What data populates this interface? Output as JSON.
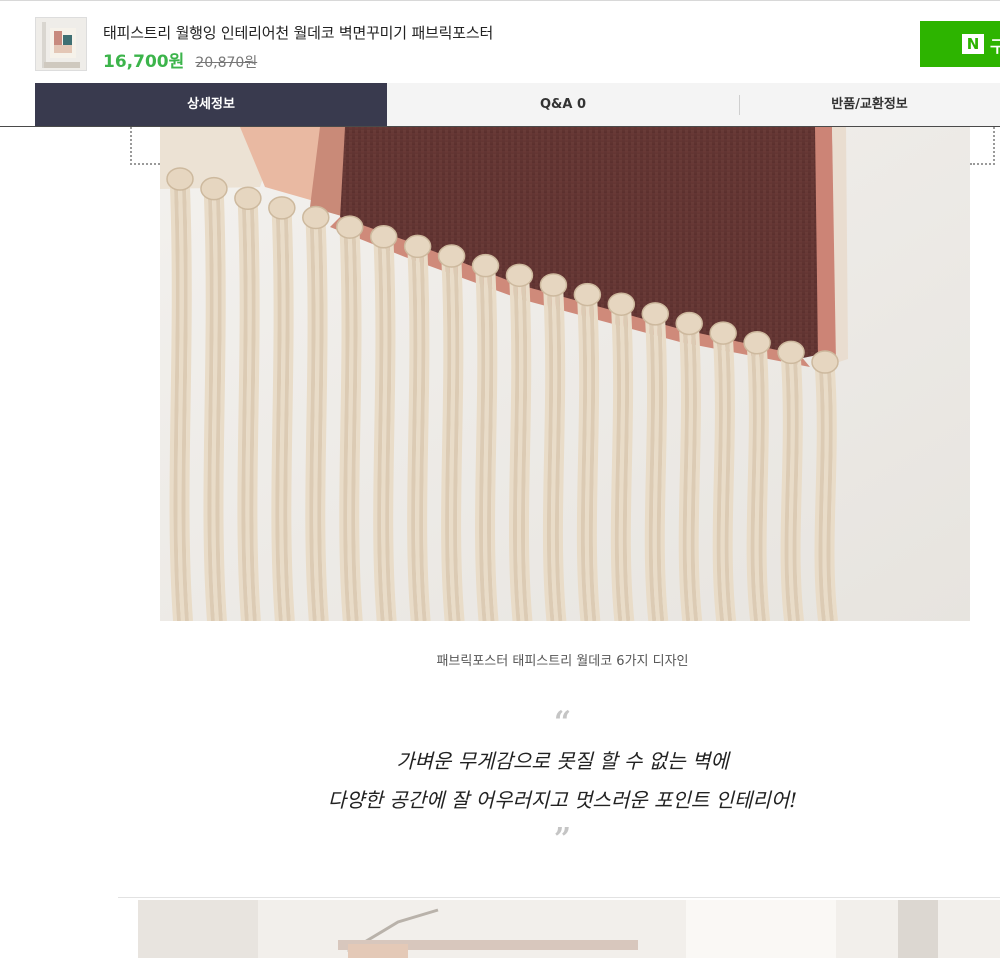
{
  "product": {
    "title": "태피스트리 월행잉 인테리어천 월데코 벽면꾸미기 패브릭포스터",
    "price": "16,700원",
    "original_price": "20,870원",
    "thumbnail_icon": "tapestry-thumbnail"
  },
  "purchase": {
    "npay_badge": "N",
    "npay_label": "구"
  },
  "tabs": [
    {
      "label": "상세정보",
      "active": true
    },
    {
      "label": "Q&A 0",
      "active": false
    },
    {
      "label": "반품/교환정보",
      "active": false
    }
  ],
  "detail": {
    "caption": "패브릭포스터 태피스트리 월데코 6가지 디자인",
    "quote_open": "“",
    "quote_lines": [
      "가벼운 무게감으로 못질 할 수 없는 벽에",
      "다양한 공간에 잘 어우러지고 멋스러운 포인트 인테리어!"
    ],
    "quote_close": "”"
  },
  "colors": {
    "accent_green": "#3cb44b",
    "npay_green": "#2db400",
    "active_tab": "#393a4e"
  }
}
